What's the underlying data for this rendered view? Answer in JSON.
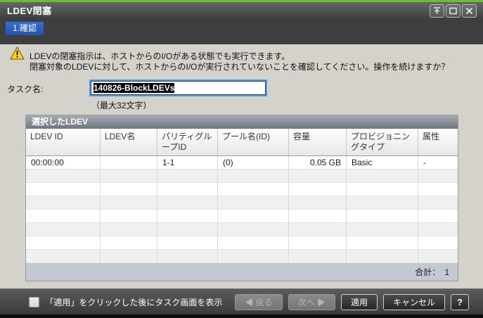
{
  "window": {
    "title": "LDEV閉塞"
  },
  "steps": {
    "current": "1.確認"
  },
  "warning": {
    "line1": "LDEVの閉塞指示は、ホストからのI/Oがある状態でも実行できます。",
    "line2": "閉塞対象のLDEVに対して、ホストからのI/Oが実行されていないことを確認してください。操作を続けますか？"
  },
  "task": {
    "label": "タスク名:",
    "value": "140826-BlockLDEVs",
    "hint": "（最大32文字）"
  },
  "table": {
    "title": "選択したLDEV",
    "columns": [
      "LDEV ID",
      "LDEV名",
      "パリティグループID",
      "プール名(ID)",
      "容量",
      "プロビジョニングタイプ",
      "属性"
    ],
    "rows": [
      [
        "00:00:00",
        "",
        "1-1",
        "(0)",
        "0.05 GB",
        "Basic",
        "-"
      ]
    ],
    "empty_row_count": 7,
    "total_label": "合計：",
    "total_value": "1"
  },
  "footer": {
    "checkbox_label": "「適用」をクリックした後にタスク画面を表示",
    "back_label": "◀ 戻る",
    "next_label": "次へ ▶",
    "apply_label": "適用",
    "cancel_label": "キャンセル",
    "help_label": "?"
  },
  "icons": {
    "titlebar": [
      "collapse-up-icon",
      "maximize-icon",
      "close-icon"
    ],
    "warning": "warning-triangle-icon"
  },
  "colors": {
    "accent_green": "#6CBE2D",
    "step_badge_blue": "#2A60C2",
    "input_focus_blue": "#3F9BFC",
    "selection_bg": "#000000",
    "table_footer_bg": "#C3C8D3",
    "warning_yellow": "#FFD21E"
  }
}
